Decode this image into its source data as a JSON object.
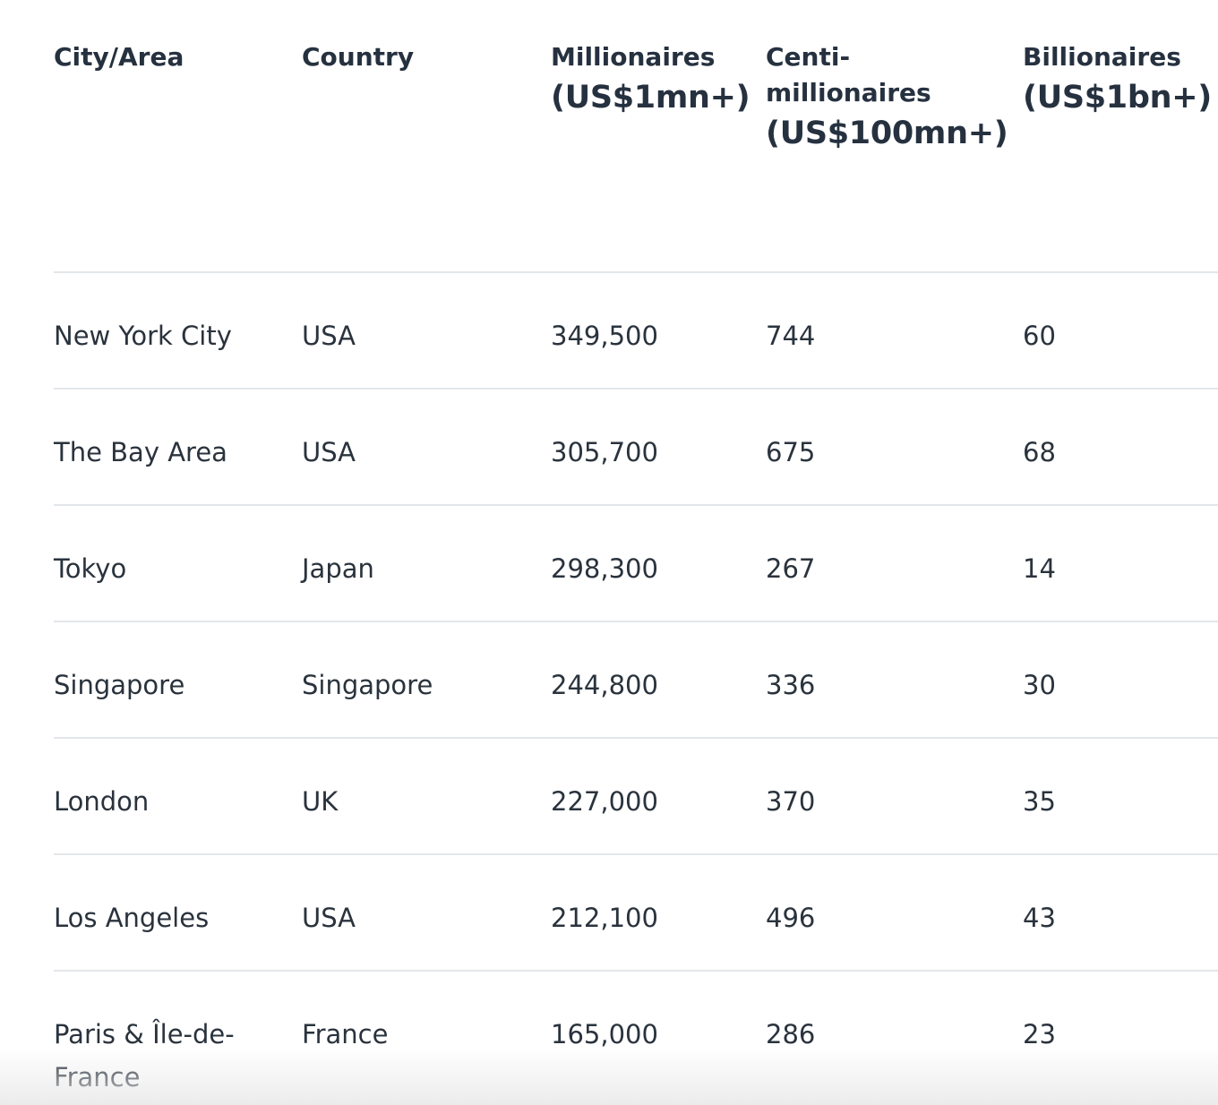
{
  "table": {
    "headers": [
      {
        "line1": "City/Area",
        "line2": "",
        "line3": ""
      },
      {
        "line1": "Country",
        "line2": "",
        "line3": ""
      },
      {
        "line1": "Millionaires",
        "line2": "(US$1mn+)",
        "line3": ""
      },
      {
        "line1": "Centi-",
        "line2": "millionaires",
        "line3": "(US$100mn+)"
      },
      {
        "line1": "Billionaires",
        "line2": "(US$1bn+)",
        "line3": ""
      }
    ],
    "rows": [
      [
        "New York City",
        "USA",
        "349,500",
        "744",
        "60"
      ],
      [
        "The Bay Area",
        "USA",
        "305,700",
        "675",
        "68"
      ],
      [
        "Tokyo",
        "Japan",
        "298,300",
        "267",
        "14"
      ],
      [
        "Singapore",
        "Singapore",
        "244,800",
        "336",
        "30"
      ],
      [
        "London",
        "UK",
        "227,000",
        "370",
        "35"
      ],
      [
        "Los Angeles",
        "USA",
        "212,100",
        "496",
        "43"
      ],
      [
        "Paris & Île-de-France",
        "France",
        "165,000",
        "286",
        "23"
      ]
    ]
  }
}
